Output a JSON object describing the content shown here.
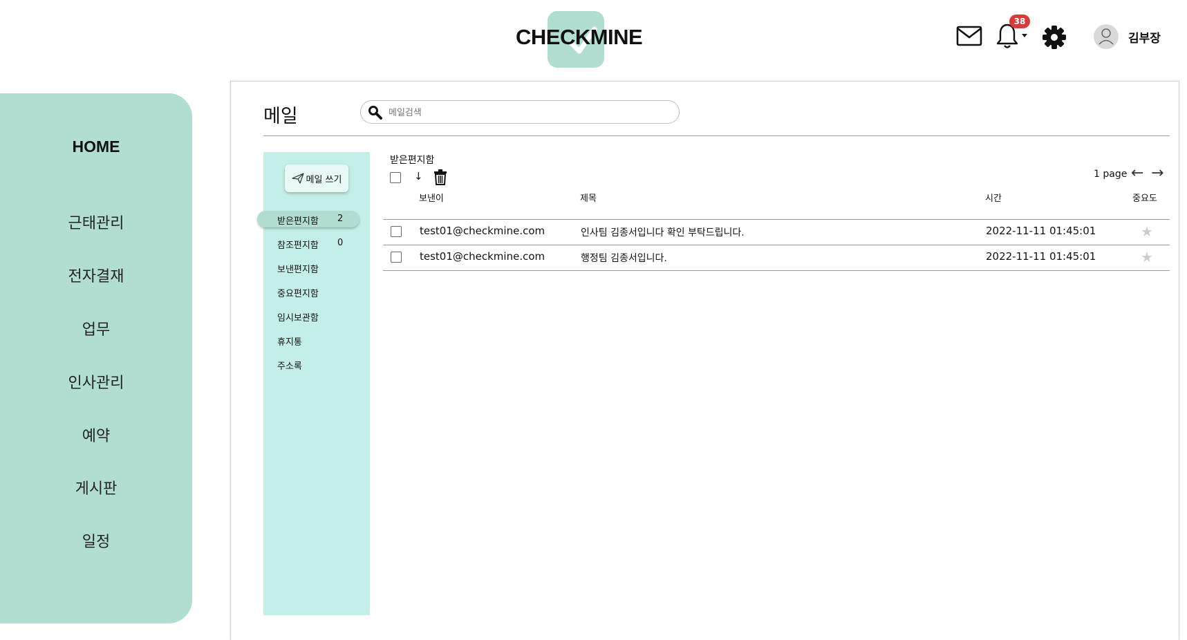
{
  "header": {
    "logo_text": "CHECKMINE",
    "notification_count": "38",
    "user_name": "김부장"
  },
  "nav": {
    "items": [
      "HOME",
      "근태관리",
      "전자결재",
      "업무",
      "인사관리",
      "예약",
      "게시판",
      "일정"
    ]
  },
  "main": {
    "title": "메일",
    "search_placeholder": "메일검색"
  },
  "folders": {
    "compose_label": "메일 쓰기",
    "items": [
      {
        "label": "받은편지함",
        "count": "2"
      },
      {
        "label": "참조편지함",
        "count": "0"
      },
      {
        "label": "보낸편지함"
      },
      {
        "label": "중요편지함"
      },
      {
        "label": "임시보관함"
      },
      {
        "label": "휴지통"
      },
      {
        "label": "주소록"
      }
    ]
  },
  "mail_list": {
    "folder_title": "받은편지함",
    "sort_symbol": "↓",
    "page_label": "1 page",
    "prev_arrow": "←",
    "next_arrow": "→",
    "columns": {
      "sender": "보낸이",
      "subject": "제목",
      "time": "시간",
      "importance": "중요도"
    },
    "rows": [
      {
        "sender": "test01@checkmine.com",
        "subject": "인사팀 김종서입니다 확인 부탁드립니다.",
        "time": "2022-11-11 01:45:01",
        "star": "★"
      },
      {
        "sender": "test01@checkmine.com",
        "subject": "행정팀 김종서입니다.",
        "time": "2022-11-11 01:45:01",
        "star": "★"
      }
    ]
  },
  "colors": {
    "sidebar": "#b2ddd3",
    "folder_panel": "#c4efe8",
    "badge": "#d83b3b"
  }
}
